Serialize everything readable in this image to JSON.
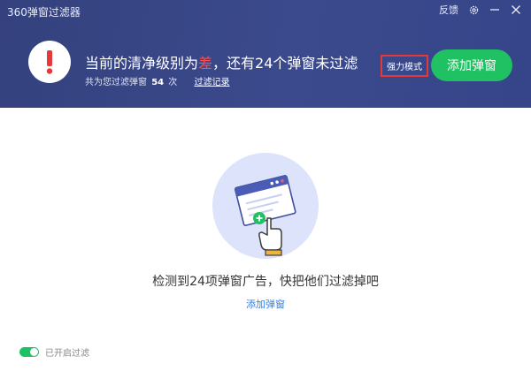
{
  "window": {
    "title": "360弹窗过滤器",
    "feedback_label": "反馈",
    "icons": [
      "gear-icon",
      "minimize-icon",
      "close-icon"
    ]
  },
  "header": {
    "alert_icon": "exclamation-icon",
    "headline_prefix": "当前的清净级别为",
    "headline_level": "差",
    "headline_suffix": "，还有24个弹窗未过滤",
    "subline_prefix": "共为您过滤弹窗",
    "filtered_count": "54",
    "subline_unit": "次",
    "log_link": "过滤记录",
    "mode_button": "强力模式",
    "add_button": "添加弹窗"
  },
  "main": {
    "illustration": "popup-window-hand-icon",
    "message": "检测到24项弹窗广告，快把他们过滤掉吧",
    "link": "添加弹窗"
  },
  "footer": {
    "toggle_on": true,
    "status_text": "已开启过滤"
  },
  "colors": {
    "header_bg": "#3b4a8c",
    "accent_green": "#20c162",
    "alert_red": "#e53838",
    "link_blue": "#2d7ee6"
  }
}
